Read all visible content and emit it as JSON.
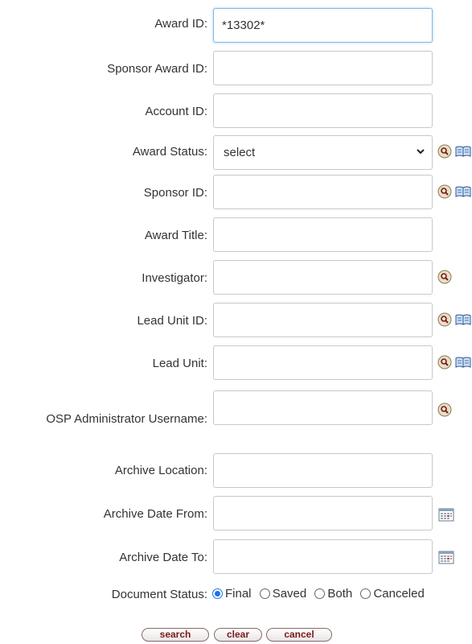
{
  "form": {
    "award_id": {
      "label": "Award ID:",
      "value": "*13302*"
    },
    "sponsor_award_id": {
      "label": "Sponsor Award ID:",
      "value": ""
    },
    "account_id": {
      "label": "Account ID:",
      "value": ""
    },
    "award_status": {
      "label": "Award Status:",
      "selected": "select"
    },
    "sponsor_id": {
      "label": "Sponsor ID:",
      "value": ""
    },
    "award_title": {
      "label": "Award Title:",
      "value": ""
    },
    "investigator": {
      "label": "Investigator:",
      "value": ""
    },
    "lead_unit_id": {
      "label": "Lead Unit ID:",
      "value": ""
    },
    "lead_unit": {
      "label": "Lead Unit:",
      "value": ""
    },
    "osp_admin": {
      "label": "OSP Administrator Username:",
      "value": ""
    },
    "archive_location": {
      "label": "Archive Location:",
      "value": ""
    },
    "archive_date_from": {
      "label": "Archive Date From:",
      "value": ""
    },
    "archive_date_to": {
      "label": "Archive Date To:",
      "value": ""
    },
    "document_status": {
      "label": "Document Status:",
      "options": [
        "Final",
        "Saved",
        "Both",
        "Canceled"
      ],
      "selected": "Final"
    }
  },
  "buttons": {
    "search": "search",
    "clear": "clear",
    "cancel": "cancel"
  },
  "colors": {
    "button_text": "#7a1a1a",
    "radio_accent": "#1a73e8",
    "focus_border": "#7fb8e8"
  }
}
